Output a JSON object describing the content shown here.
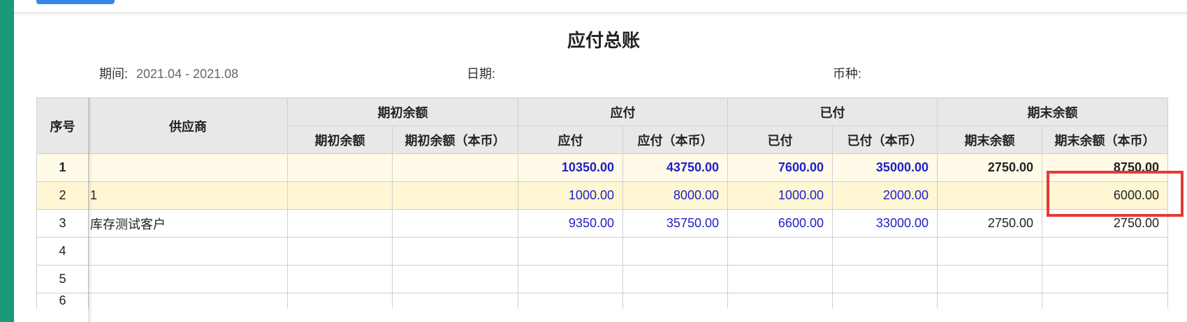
{
  "report": {
    "title": "应付总账",
    "period_label": "期间:",
    "period_value": "2021.04 - 2021.08",
    "date_label": "日期:",
    "currency_label": "币种:"
  },
  "table": {
    "header": {
      "index": "序号",
      "supplier": "供应商",
      "groups": [
        "期初余额",
        "应付",
        "已付",
        "期末余额"
      ],
      "subcolumns": [
        "期初余额",
        "期初余额（本币）",
        "应付",
        "应付（本币）",
        "已付",
        "已付（本币）",
        "期末余额",
        "期末余额（本币）"
      ]
    },
    "rows": [
      {
        "index": "1",
        "supplier": "",
        "opening": "",
        "opening_local": "",
        "payable": "10350.00",
        "payable_local": "43750.00",
        "paid": "7600.00",
        "paid_local": "35000.00",
        "closing": "2750.00",
        "closing_local": "8750.00"
      },
      {
        "index": "2",
        "supplier": "1",
        "opening": "",
        "opening_local": "",
        "payable": "1000.00",
        "payable_local": "8000.00",
        "paid": "1000.00",
        "paid_local": "2000.00",
        "closing": "",
        "closing_local": "6000.00"
      },
      {
        "index": "3",
        "supplier": "库存测试客户",
        "opening": "",
        "opening_local": "",
        "payable": "9350.00",
        "payable_local": "35750.00",
        "paid": "6600.00",
        "paid_local": "33000.00",
        "closing": "2750.00",
        "closing_local": "2750.00"
      },
      {
        "index": "4"
      },
      {
        "index": "5"
      },
      {
        "index": "6"
      }
    ]
  },
  "colors": {
    "accent_green": "#1a9a77",
    "amount_blue": "#2020c8",
    "highlight_red": "#e53935"
  }
}
